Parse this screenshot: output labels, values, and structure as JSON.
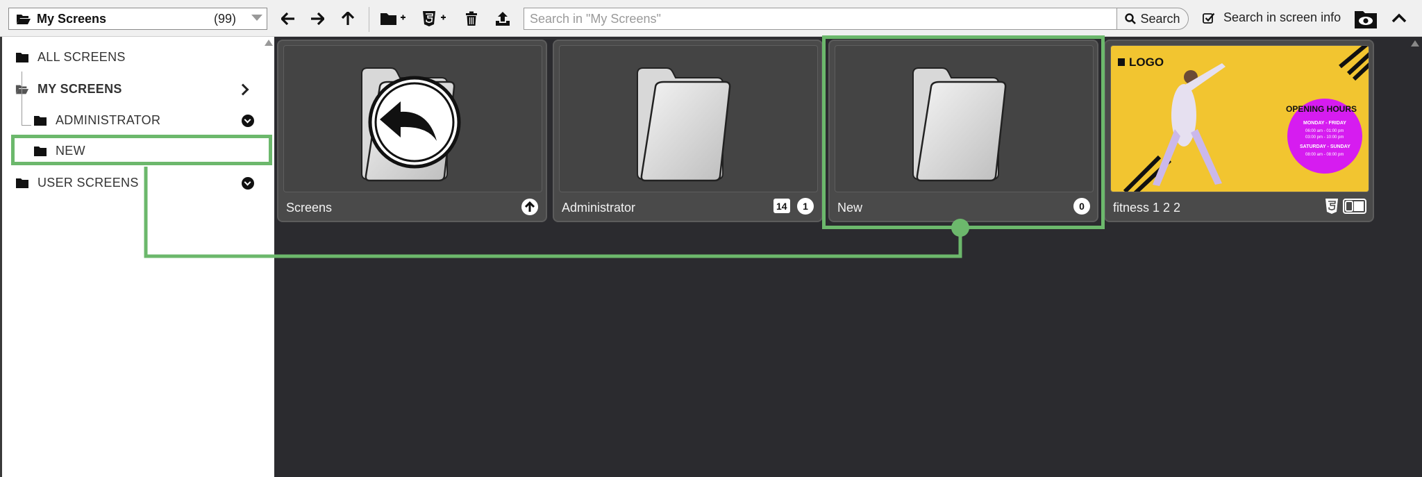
{
  "toolbar": {
    "folder_select": {
      "title": "My Screens",
      "count": "(99)"
    },
    "search_placeholder": "Search in \"My Screens\"",
    "search_label": "Search",
    "search_info_label": "Search in screen info"
  },
  "sidebar": {
    "items": [
      {
        "label": "ALL SCREENS"
      },
      {
        "label": "MY SCREENS"
      },
      {
        "label": "ADMINISTRATOR"
      },
      {
        "label": "NEW"
      },
      {
        "label": "USER SCREENS"
      }
    ]
  },
  "cards": [
    {
      "label": "Screens",
      "icon": "folder-up"
    },
    {
      "label": "Administrator",
      "icon": "folder",
      "badges": [
        "14",
        "1"
      ]
    },
    {
      "label": "New",
      "icon": "folder",
      "badges": [
        "0"
      ]
    },
    {
      "label": "fitness 1 2 2",
      "icon": "html5-screen"
    }
  ],
  "fitness_thumb": {
    "logo": "LOGO",
    "heading": "OPENING HOURS",
    "days1": "MONDAY - FRIDAY",
    "hours1a": "06:00 am - 01:00 pm",
    "hours1b": "03:00 pm - 10:00 pm",
    "days2": "SATURDAY - SUNDAY",
    "hours2": "08:00 am - 08:00 pm"
  },
  "colors": {
    "highlight": "#6cb86c",
    "toolbar_bg": "#f0f0f0",
    "main_bg": "#2b2b2f",
    "card_bg": "#4a4a4a",
    "fitness_yellow": "#f2c530",
    "fitness_magenta": "#d61cf0"
  }
}
